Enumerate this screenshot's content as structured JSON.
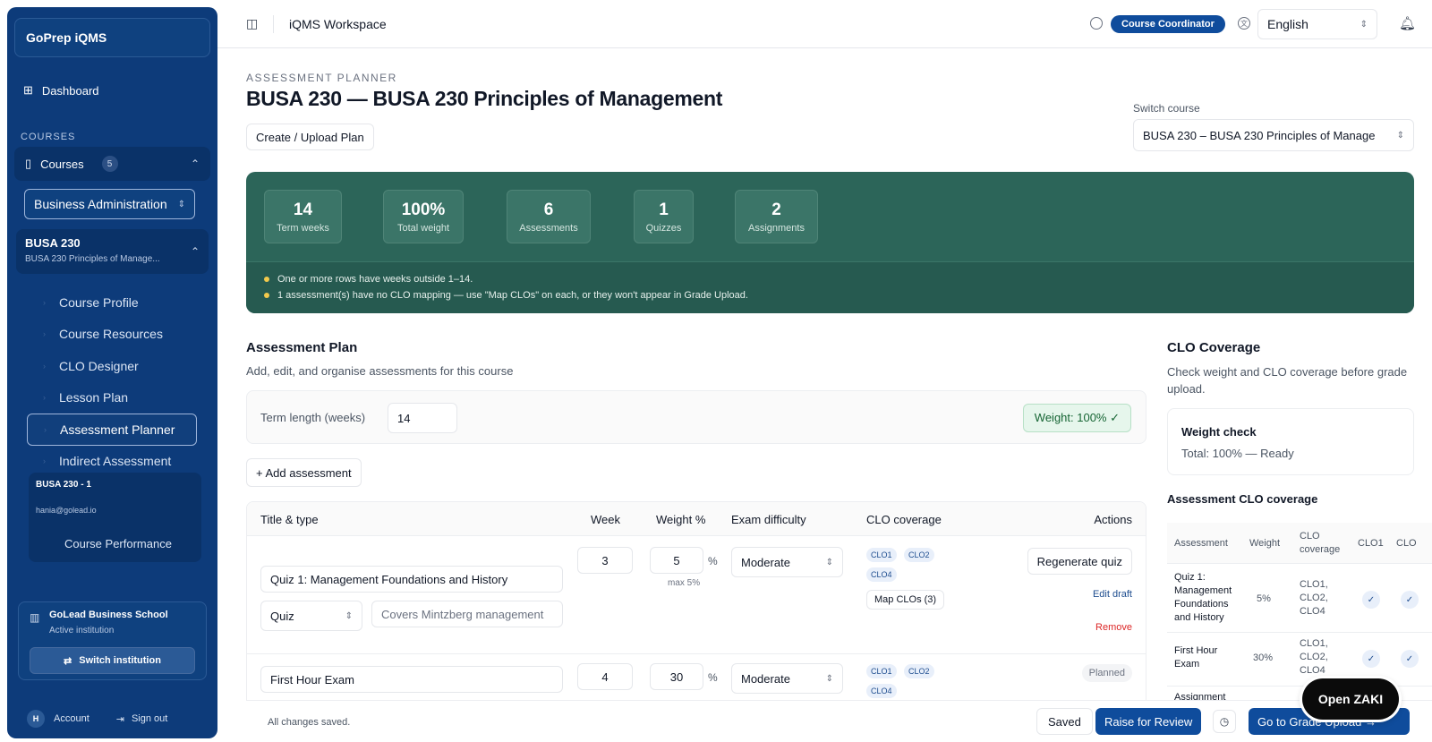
{
  "sidebar": {
    "brand": "GoPrep iQMS",
    "dashboard": "Dashboard",
    "section_label": "COURSES",
    "courses_label": "Courses",
    "courses_count": "5",
    "program": "Business Administration",
    "course_code": "BUSA 230",
    "course_name": "BUSA 230 Principles of Manage...",
    "subnav": [
      "Course Profile",
      "Course Resources",
      "CLO Designer",
      "Lesson Plan",
      "Assessment Planner",
      "Indirect Assessment"
    ],
    "offering_title": "BUSA 230 - 1",
    "offering_email": "hania@golead.io",
    "offering_perf": "Course Performance",
    "institution_name": "GoLead Business School",
    "institution_status": "Active institution",
    "switch_institution": "Switch institution",
    "account_initial": "H",
    "account": "Account",
    "sign_out": "Sign out"
  },
  "topbar": {
    "workspace": "iQMS Workspace",
    "role": "Course Coordinator",
    "language": "English"
  },
  "header": {
    "eyebrow": "ASSESSMENT PLANNER",
    "title": "BUSA 230 — BUSA 230 Principles of Management",
    "create_button": "Create / Upload Plan",
    "switch_label": "Switch course",
    "switch_value": "BUSA 230 – BUSA 230 Principles of Manage"
  },
  "stats": [
    {
      "value": "14",
      "label": "Term weeks"
    },
    {
      "value": "100%",
      "label": "Total weight"
    },
    {
      "value": "6",
      "label": "Assessments"
    },
    {
      "value": "1",
      "label": "Quizzes"
    },
    {
      "value": "2",
      "label": "Assignments"
    }
  ],
  "warnings": [
    "One or more rows have weeks outside 1–14.",
    "1 assessment(s) have no CLO mapping — use \"Map CLOs\" on each, or they won't appear in Grade Upload."
  ],
  "plan": {
    "title": "Assessment Plan",
    "subtitle": "Add, edit, and organise assessments for this course",
    "term_label": "Term length (weeks)",
    "term_value": "14",
    "weight_badge": "Weight: 100% ✓",
    "add_button": "+ Add assessment",
    "columns": [
      "Title & type",
      "Week",
      "Weight %",
      "Exam difficulty",
      "CLO coverage",
      "Actions"
    ],
    "rows": [
      {
        "title": "Quiz 1: Management Foundations and History",
        "type": "Quiz",
        "covers": "Covers Mintzberg management",
        "week": "3",
        "weight": "5",
        "pct": "%",
        "max": "max 5%",
        "difficulty": "Moderate",
        "clos": [
          "CLO1",
          "CLO2",
          "CLO4"
        ],
        "map_button": "Map CLOs (3)",
        "regen": "Regenerate quiz",
        "edit": "Edit draft",
        "remove": "Remove"
      },
      {
        "title": "First Hour Exam",
        "week": "4",
        "weight": "30",
        "pct": "%",
        "difficulty": "Moderate",
        "clos": [
          "CLO1",
          "CLO2",
          "CLO4"
        ],
        "status": "Planned"
      }
    ]
  },
  "coverage": {
    "title": "CLO Coverage",
    "subtitle": "Check weight and CLO coverage before grade upload.",
    "weight_check_title": "Weight check",
    "weight_check_value": "Total: 100% — Ready",
    "table_title": "Assessment CLO coverage",
    "headers": [
      "Assessment",
      "Weight",
      "CLO coverage",
      "CLO1",
      "CLO"
    ],
    "rows": [
      {
        "name": "Quiz 1: Management Foundations and History",
        "weight": "5%",
        "coverage": "CLO1, CLO2, CLO4",
        "check": "✓"
      },
      {
        "name": "First Hour Exam",
        "weight": "30%",
        "coverage": "CLO1, CLO2, CLO4",
        "check": "✓"
      },
      {
        "name": "Assignment"
      }
    ]
  },
  "bottombar": {
    "status": "All changes saved.",
    "saved": "Saved",
    "review": "Raise for Review",
    "grade_upload": "Go to Grade Upload →"
  },
  "chat_button": "Open ZAKI"
}
